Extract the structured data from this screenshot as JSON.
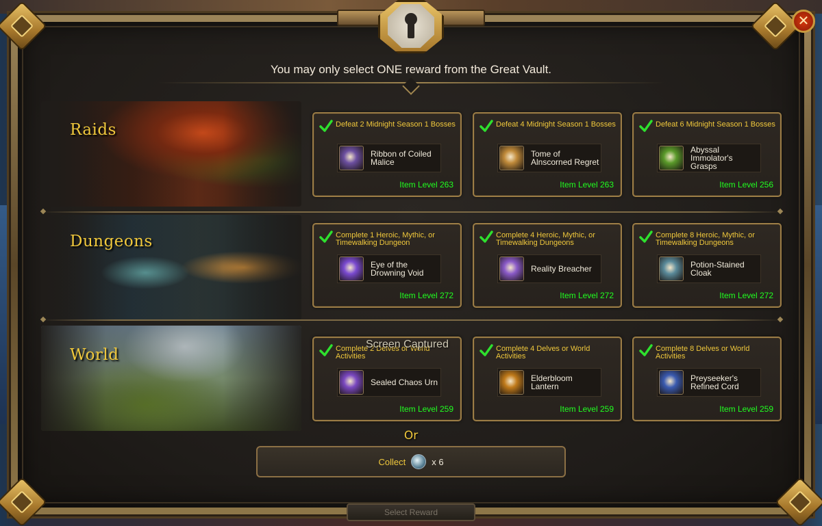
{
  "window": {
    "close_label": "✕"
  },
  "header": {
    "message": "You may only select ONE reward from the Great Vault."
  },
  "rows": [
    {
      "title": "Raids",
      "rewards": [
        {
          "requirement": "Defeat 2 Midnight Season 1 Bosses",
          "item": "Ribbon of Coiled Malice",
          "item_level": "Item Level 263",
          "icon": "ribbon-icon",
          "icon_color": "#6c4fa0",
          "unlocked": true
        },
        {
          "requirement": "Defeat 4 Midnight Season 1 Bosses",
          "item": "Tome of Alnscorned Regret",
          "item_level": "Item Level 263",
          "icon": "tome-icon",
          "icon_color": "#c08a3a",
          "unlocked": true
        },
        {
          "requirement": "Defeat 6 Midnight Season 1 Bosses",
          "item": "Abyssal Immolator's Grasps",
          "item_level": "Item Level 256",
          "icon": "gloves-icon",
          "icon_color": "#5a9a2a",
          "unlocked": true
        }
      ]
    },
    {
      "title": "Dungeons",
      "rewards": [
        {
          "requirement": "Complete 1 Heroic, Mythic, or Timewalking Dungeon",
          "item": "Eye of the Drowning Void",
          "item_level": "Item Level 272",
          "icon": "eye-orb-icon",
          "icon_color": "#7a4ad0",
          "unlocked": true
        },
        {
          "requirement": "Complete 4 Heroic, Mythic, or Timewalking Dungeons",
          "item": "Reality Breacher",
          "item_level": "Item Level 272",
          "icon": "star-burst-icon",
          "icon_color": "#8a5ac8",
          "unlocked": true
        },
        {
          "requirement": "Complete 8 Heroic, Mythic, or Timewalking Dungeons",
          "item": "Potion-Stained Cloak",
          "item_level": "Item Level 272",
          "icon": "cloak-icon",
          "icon_color": "#5a8a9a",
          "unlocked": true
        }
      ]
    },
    {
      "title": "World",
      "rewards": [
        {
          "requirement": "Complete 2 Delves or World Activities",
          "item": "Sealed Chaos Urn",
          "item_level": "Item Level 259",
          "icon": "urn-icon",
          "icon_color": "#7a48c0",
          "unlocked": true
        },
        {
          "requirement": "Complete 4 Delves or World Activities",
          "item": "Elderbloom Lantern",
          "item_level": "Item Level 259",
          "icon": "lantern-icon",
          "icon_color": "#c07a1a",
          "unlocked": true
        },
        {
          "requirement": "Complete 8 Delves or World Activities",
          "item": "Preyseeker's Refined Cord",
          "item_level": "Item Level 259",
          "icon": "cord-icon",
          "icon_color": "#3a5ab0",
          "unlocked": true
        }
      ]
    }
  ],
  "alternative": {
    "or_label": "Or",
    "collect_label": "Collect",
    "currency_icon": "currency-orb-icon",
    "collect_count": "x 6"
  },
  "footer": {
    "select_label": "Select Reward"
  },
  "overlay": {
    "watermark": "Screen Captured"
  },
  "colors": {
    "gold_text": "#f0c83c",
    "item_level_green": "#20ff20",
    "frame_gold": "#9c7d46",
    "close_red": "#d83a0e"
  }
}
